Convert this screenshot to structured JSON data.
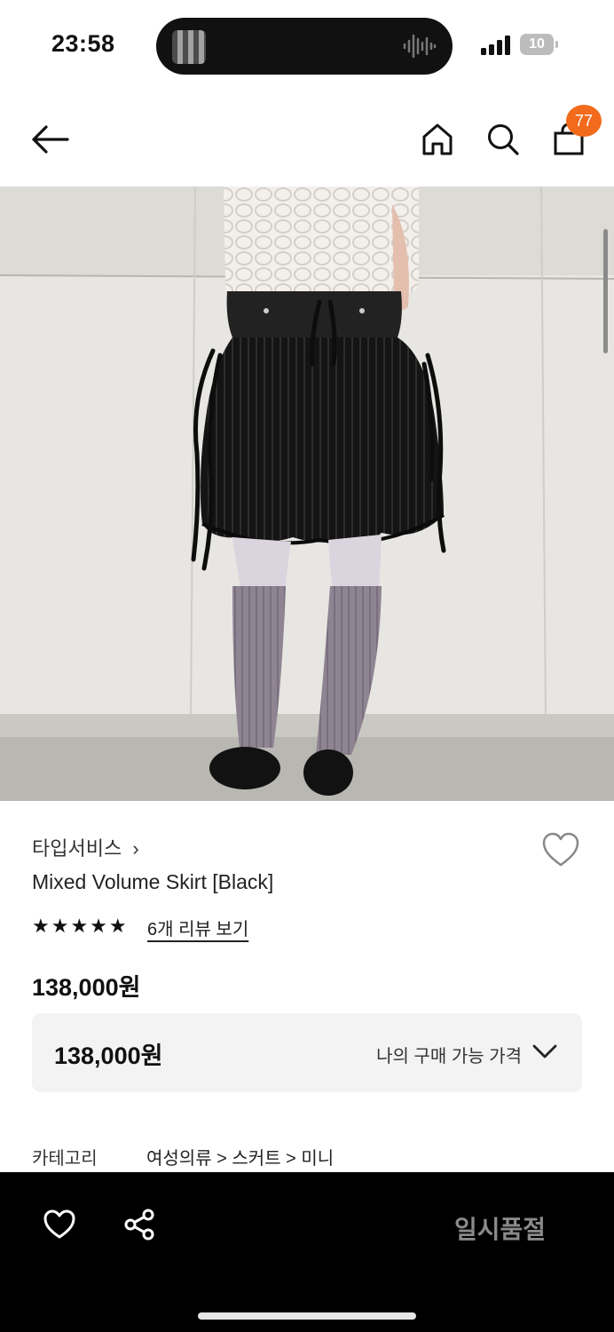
{
  "status_bar": {
    "time": "23:58",
    "battery": "10"
  },
  "header": {
    "cart_count": "77"
  },
  "product": {
    "brand": "타입서비스",
    "brand_chevron": "›",
    "name": "Mixed Volume Skirt [Black]",
    "stars": "★★★★★",
    "rating": 5,
    "reviews_link": "6개 리뷰 보기",
    "price": "138,000원"
  },
  "my_price": {
    "price": "138,000원",
    "label": "나의 구매 가능 가격"
  },
  "category": {
    "label": "카테고리",
    "path": "여성의류 > 스커트 > 미니"
  },
  "bottom_bar": {
    "action_label": "일시품절"
  },
  "colors": {
    "accent": "#f26a1b",
    "bottom_bar": "#000000",
    "disabled_text": "#8a8a8a"
  }
}
